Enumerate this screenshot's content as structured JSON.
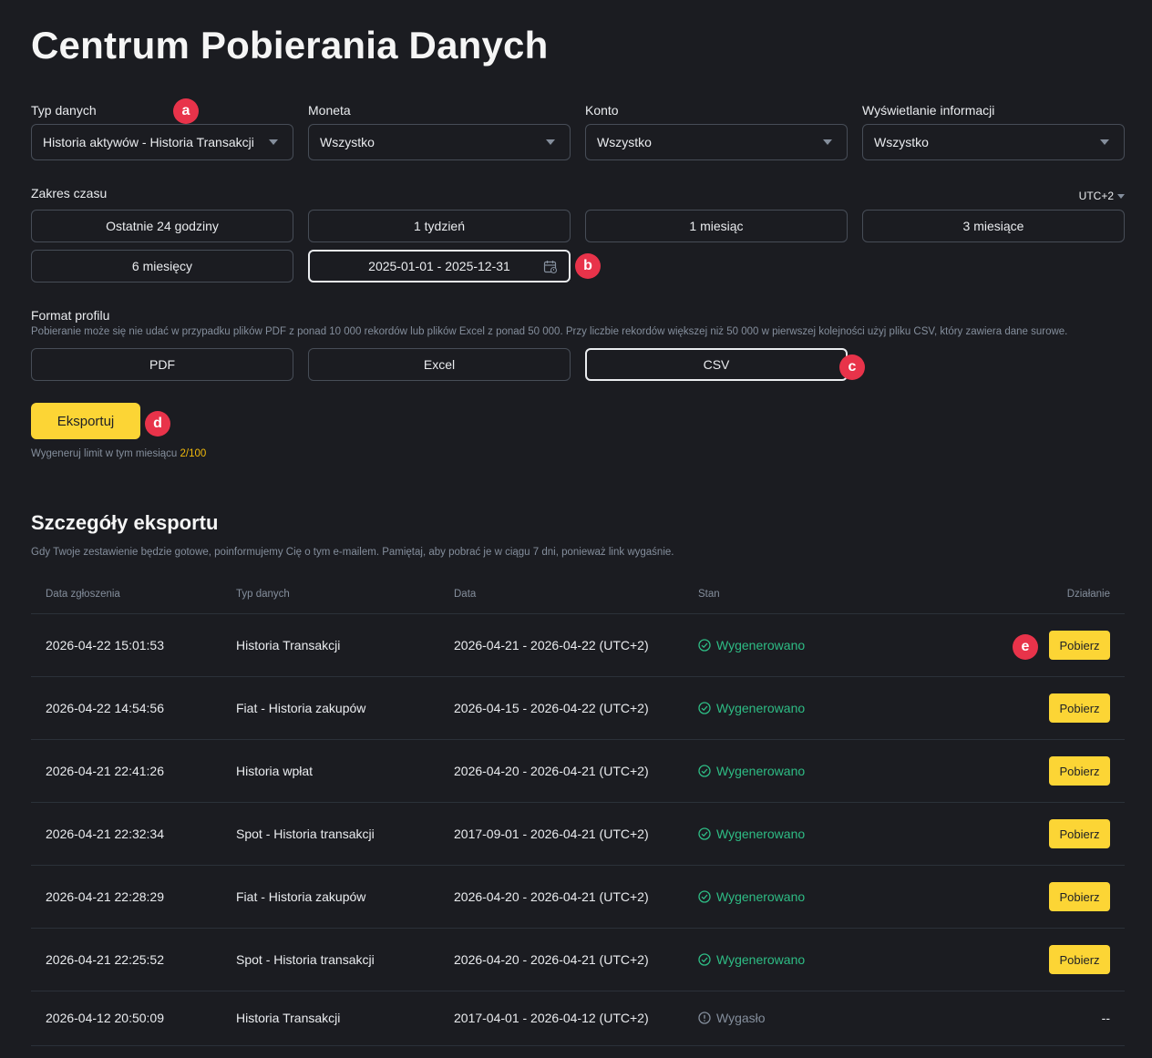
{
  "title": "Centrum Pobierania Danych",
  "filters": [
    {
      "label": "Typ danych",
      "value": "Historia aktywów - Historia Transakcji"
    },
    {
      "label": "Moneta",
      "value": "Wszystko"
    },
    {
      "label": "Konto",
      "value": "Wszystko"
    },
    {
      "label": "Wyświetlanie informacji",
      "value": "Wszystko"
    }
  ],
  "time_range": {
    "label": "Zakres czasu",
    "timezone": "UTC+2",
    "options": [
      "Ostatnie 24 godziny",
      "1 tydzień",
      "1 miesiąc",
      "3 miesiące",
      "6 miesięcy"
    ],
    "custom_range": "2025-01-01 - 2025-12-31"
  },
  "format": {
    "label": "Format profilu",
    "note": "Pobieranie może się nie udać w przypadku plików PDF z ponad 10 000 rekordów lub plików Excel z ponad 50 000. Przy liczbie rekordów większej niż 50 000 w pierwszej kolejności użyj pliku CSV, który zawiera dane surowe.",
    "options": [
      "PDF",
      "Excel",
      "CSV"
    ],
    "selected": "CSV"
  },
  "export": {
    "button": "Eksportuj",
    "limit_label": "Wygeneruj limit w tym miesiącu",
    "limit_value": "2/100"
  },
  "details": {
    "title": "Szczegóły eksportu",
    "note": "Gdy Twoje zestawienie będzie gotowe, poinformujemy Cię o tym e-mailem. Pamiętaj, aby pobrać je w ciągu 7 dni, ponieważ link wygaśnie.",
    "columns": [
      "Data zgłoszenia",
      "Typ danych",
      "Data",
      "Stan",
      "Działanie"
    ],
    "rows": [
      {
        "submitted": "2026-04-22 15:01:53",
        "type": "Historia Transakcji",
        "range": "2026-04-21 - 2026-04-22 (UTC+2)",
        "status": "Wygenerowano",
        "action": "Pobierz"
      },
      {
        "submitted": "2026-04-22 14:54:56",
        "type": "Fiat - Historia zakupów",
        "range": "2026-04-15 - 2026-04-22 (UTC+2)",
        "status": "Wygenerowano",
        "action": "Pobierz"
      },
      {
        "submitted": "2026-04-21 22:41:26",
        "type": "Historia wpłat",
        "range": "2026-04-20 - 2026-04-21 (UTC+2)",
        "status": "Wygenerowano",
        "action": "Pobierz"
      },
      {
        "submitted": "2026-04-21 22:32:34",
        "type": "Spot - Historia transakcji",
        "range": "2017-09-01 - 2026-04-21 (UTC+2)",
        "status": "Wygenerowano",
        "action": "Pobierz"
      },
      {
        "submitted": "2026-04-21 22:28:29",
        "type": "Fiat - Historia zakupów",
        "range": "2026-04-20 - 2026-04-21 (UTC+2)",
        "status": "Wygenerowano",
        "action": "Pobierz"
      },
      {
        "submitted": "2026-04-21 22:25:52",
        "type": "Spot - Historia transakcji",
        "range": "2026-04-20 - 2026-04-21 (UTC+2)",
        "status": "Wygenerowano",
        "action": "Pobierz"
      },
      {
        "submitted": "2026-04-12 20:50:09",
        "type": "Historia Transakcji",
        "range": "2017-04-01 - 2026-04-12 (UTC+2)",
        "status": "Wygasło",
        "action": "--"
      }
    ]
  },
  "annotations": [
    "a",
    "b",
    "c",
    "d",
    "e"
  ],
  "colors": {
    "accent": "#fcd535",
    "success": "#2ebd85",
    "badge": "#e8334a",
    "background": "#1b1c21"
  }
}
